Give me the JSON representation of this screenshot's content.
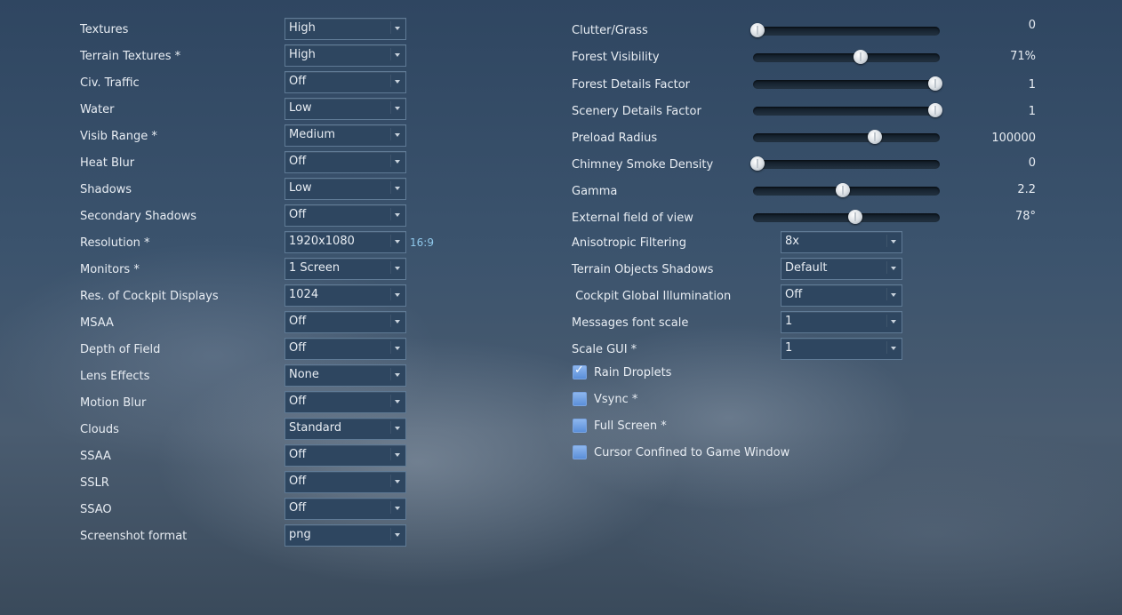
{
  "left_settings": [
    {
      "label": "Textures",
      "value": "High"
    },
    {
      "label": "Terrain Textures *",
      "value": "High"
    },
    {
      "label": "Civ. Traffic",
      "value": "Off"
    },
    {
      "label": "Water",
      "value": "Low"
    },
    {
      "label": "Visib Range *",
      "value": "Medium"
    },
    {
      "label": "Heat Blur",
      "value": "Off"
    },
    {
      "label": "Shadows",
      "value": "Low"
    },
    {
      "label": "Secondary Shadows",
      "value": "Off"
    },
    {
      "label": "Resolution *",
      "value": "1920x1080",
      "note": "16:9"
    },
    {
      "label": "Monitors *",
      "value": "1 Screen"
    },
    {
      "label": "Res. of Cockpit Displays",
      "value": "1024"
    },
    {
      "label": "MSAA",
      "value": "Off"
    },
    {
      "label": "Depth of Field",
      "value": "Off"
    },
    {
      "label": "Lens Effects",
      "value": "None"
    },
    {
      "label": "Motion Blur",
      "value": "Off"
    },
    {
      "label": "Clouds",
      "value": "Standard"
    },
    {
      "label": "SSAA",
      "value": "Off"
    },
    {
      "label": "SSLR",
      "value": "Off"
    },
    {
      "label": "SSAO",
      "value": "Off"
    },
    {
      "label": "Screenshot format",
      "value": "png"
    }
  ],
  "sliders": [
    {
      "label": "Clutter/Grass",
      "value": "0",
      "level": 0.0
    },
    {
      "label": "Forest Visibility",
      "value": "71%",
      "level": 0.58
    },
    {
      "label": "Forest Details Factor",
      "value": "1",
      "level": 1.0
    },
    {
      "label": "Scenery Details Factor",
      "value": "1",
      "level": 1.0
    },
    {
      "label": "Preload Radius",
      "value": "100000",
      "level": 0.66
    },
    {
      "label": "Chimney Smoke Density",
      "value": "0",
      "level": 0.0
    },
    {
      "label": "Gamma",
      "value": "2.2",
      "level": 0.48
    },
    {
      "label": "External field of view",
      "value": "78°",
      "level": 0.55
    }
  ],
  "right_dropdowns": [
    {
      "label": "Anisotropic Filtering",
      "value": "8x"
    },
    {
      "label": "Terrain Objects Shadows",
      "value": "Default"
    },
    {
      "label": " Cockpit Global Illumination",
      "value": "Off"
    },
    {
      "label": "Messages font scale",
      "value": "1"
    },
    {
      "label": "Scale GUI *",
      "value": "1"
    }
  ],
  "checkboxes": [
    {
      "label": "Rain Droplets",
      "checked": true
    },
    {
      "label": "Vsync *",
      "checked": false
    },
    {
      "label": "Full Screen *",
      "checked": false
    },
    {
      "label": "Cursor Confined to Game Window",
      "checked": false
    }
  ]
}
